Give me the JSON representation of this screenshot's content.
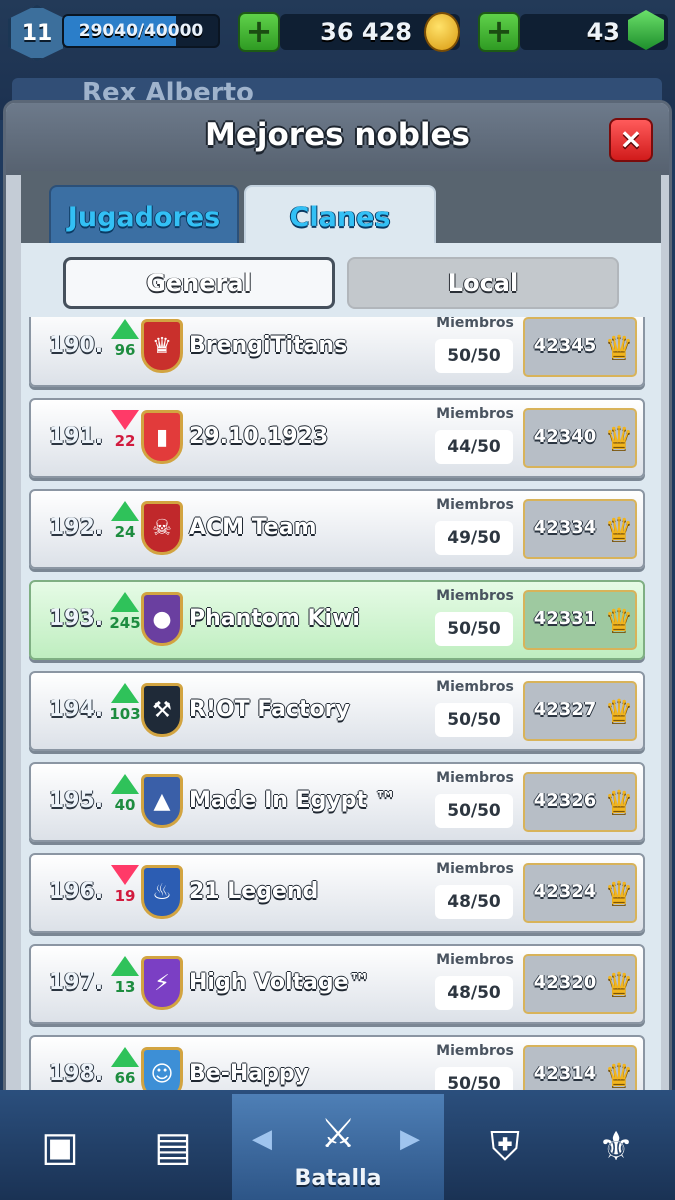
{
  "top_bar": {
    "level": "11",
    "xp": "29040/40000",
    "xp_fraction": 0.726,
    "gold": "36 428",
    "gems": "43"
  },
  "profile": {
    "name": "Rex Alberto"
  },
  "modal": {
    "title": "Mejores nobles",
    "close_icon": "×",
    "tabs": [
      "Jugadores",
      "Clanes"
    ],
    "active_tab": "Clanes",
    "subtabs": [
      "General",
      "Local"
    ],
    "active_subtab": "General",
    "members_label": "Miembros"
  },
  "rows": [
    {
      "rank": "190.",
      "trend": "up",
      "delta": "96",
      "name": "BrengiTitans",
      "members": "50/50",
      "trophies": "42345",
      "badge_color": "#c9302c",
      "badge_icon": "♛",
      "highlight": false
    },
    {
      "rank": "191.",
      "trend": "down",
      "delta": "22",
      "name": "29.10.1923",
      "members": "44/50",
      "trophies": "42340",
      "badge_color": "#e23b3b",
      "badge_icon": "▮",
      "highlight": false
    },
    {
      "rank": "192.",
      "trend": "up",
      "delta": "24",
      "name": "ACM Team",
      "members": "49/50",
      "trophies": "42334",
      "badge_color": "#c0282b",
      "badge_icon": "☠",
      "highlight": false
    },
    {
      "rank": "193.",
      "trend": "up",
      "delta": "245",
      "name": "Phantom Kiwi",
      "members": "50/50",
      "trophies": "42331",
      "badge_color": "#6a3fa0",
      "badge_icon": "●",
      "highlight": true
    },
    {
      "rank": "194.",
      "trend": "up",
      "delta": "103",
      "name": "R!OT Factory",
      "members": "50/50",
      "trophies": "42327",
      "badge_color": "#1f2a38",
      "badge_icon": "⚒",
      "highlight": false
    },
    {
      "rank": "195.",
      "trend": "up",
      "delta": "40",
      "name": "Made In Egypt ™",
      "members": "50/50",
      "trophies": "42326",
      "badge_color": "#3a5fa8",
      "badge_icon": "▲",
      "highlight": false
    },
    {
      "rank": "196.",
      "trend": "down",
      "delta": "19",
      "name": "21 Legend",
      "members": "48/50",
      "trophies": "42324",
      "badge_color": "#2c5db3",
      "badge_icon": "♨",
      "highlight": false
    },
    {
      "rank": "197.",
      "trend": "up",
      "delta": "13",
      "name": "High Voltage™",
      "members": "48/50",
      "trophies": "42320",
      "badge_color": "#7b3fc4",
      "badge_icon": "⚡",
      "highlight": false
    },
    {
      "rank": "198.",
      "trend": "up",
      "delta": "66",
      "name": "Be-Happy",
      "members": "50/50",
      "trophies": "42314",
      "badge_color": "#3d8fd6",
      "badge_icon": "☺",
      "highlight": false
    }
  ],
  "bottom_nav": {
    "battle_label": "Batalla",
    "icons": [
      "chest-icon",
      "cards-icon",
      "swords-icon",
      "clan-icon",
      "tournament-icon"
    ]
  },
  "colors": {
    "accent_tab_text": "#33c0f5",
    "trend_up": "#2fc25a",
    "trend_down": "#ff3a68",
    "highlight_row": "#bfeec0",
    "trophy_gold": "#f2b51e"
  }
}
